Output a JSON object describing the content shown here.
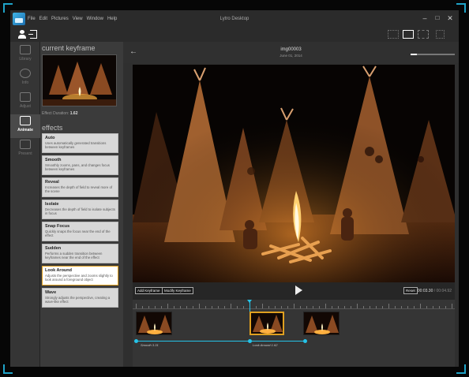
{
  "window": {
    "title": "Lytro Desktop",
    "menu": [
      "File",
      "Edit",
      "Pictures",
      "View",
      "Window",
      "Help"
    ]
  },
  "nav": {
    "items": [
      {
        "label": "Library",
        "icon": "library-icon"
      },
      {
        "label": "Info",
        "icon": "info-icon"
      },
      {
        "label": "Adjust",
        "icon": "adjust-icon"
      },
      {
        "label": "Animate",
        "icon": "animate-icon",
        "active": true
      },
      {
        "label": "Present",
        "icon": "present-icon"
      }
    ]
  },
  "panel": {
    "keyframe_title": "current keyframe",
    "duration_label": "Effect Duration:",
    "duration_value": "1.62",
    "effects_title": "effects",
    "effects": [
      {
        "name": "Auto",
        "desc": "Uses automatically generated transitions between keyframes"
      },
      {
        "name": "Smooth",
        "desc": "Smoothly zooms, pans, and changes focus between keyframes"
      },
      {
        "name": "Reveal",
        "desc": "Increases the depth of field to reveal more of the scene"
      },
      {
        "name": "Isolate",
        "desc": "Decreases the depth of field to isolate subjects in focus"
      },
      {
        "name": "Snap Focus",
        "desc": "Quickly snaps the focus near the end of the effect"
      },
      {
        "name": "Sudden",
        "desc": "Performs a sudden transition between keyframes near the end of the effect"
      },
      {
        "name": "Look Around",
        "desc": "Adjusts the perspective and zooms slightly to look around a foreground object",
        "selected": true
      },
      {
        "name": "Wave",
        "desc": "Strongly adjusts the perspective, creating a wave-like effect"
      }
    ]
  },
  "viewer": {
    "image_name": "img00003",
    "image_date": "June 01, 2014",
    "zoom_fraction": 0.15
  },
  "controls": {
    "add_keyframe": "Add Keyframe",
    "modify_keyframe": "Modify Keyframe",
    "reset": "Reset",
    "time_current": "00:03.30",
    "time_total": "/ 00:04.92"
  },
  "timeline": {
    "segments": [
      {
        "label": "Smooth  3.31"
      },
      {
        "label": "Look Around  1.62"
      }
    ]
  },
  "colors": {
    "accent": "#25c3e8",
    "selected_border": "#e0a020"
  }
}
